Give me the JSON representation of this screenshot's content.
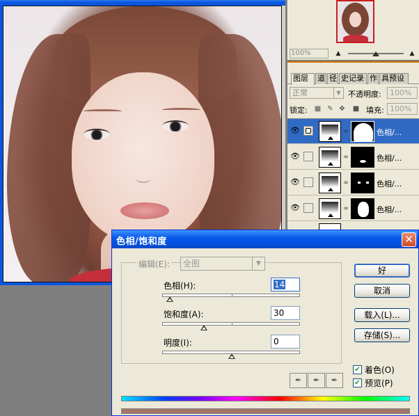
{
  "navigator": {
    "zoom": "100%"
  },
  "layers_panel": {
    "tabs": [
      "图层",
      "通道",
      "路径",
      "历史记录",
      "动作",
      "工具预设"
    ],
    "tab_labels_visible": [
      "图层",
      "道",
      "径",
      "史记录",
      "作",
      "具预设"
    ],
    "blend_mode": "正常",
    "opacity_label": "不透明度:",
    "opacity_value": "100%",
    "lock_label": "锁定:",
    "fill_label": "填充:",
    "fill_value": "100%",
    "layers": [
      {
        "name": "色相/...",
        "visible": true,
        "selected": true,
        "mask": "face-hair"
      },
      {
        "name": "色相/...",
        "visible": true,
        "selected": false,
        "mask": "lips"
      },
      {
        "name": "色相/...",
        "visible": true,
        "selected": false,
        "mask": "eyes"
      },
      {
        "name": "色相/...",
        "visible": true,
        "selected": false,
        "mask": "face"
      }
    ]
  },
  "dialog": {
    "title": "色相/饱和度",
    "edit_label": "编辑(E):",
    "edit_value": "全图",
    "hue_label": "色相(H):",
    "hue_value": "14",
    "saturation_label": "饱和度(A):",
    "saturation_value": "30",
    "lightness_label": "明度(I):",
    "lightness_value": "0",
    "hue_position": 0.05,
    "saturation_position": 0.3,
    "lightness_position": 0.5,
    "ok_label": "好",
    "cancel_label": "取消",
    "load_label": "载入(L)...",
    "save_label": "存储(S)...",
    "colorize_label": "着色(O)",
    "colorize_checked": true,
    "preview_label": "预览(P)",
    "preview_checked": true,
    "colorized_color": "#a4766a"
  },
  "colors": {
    "xp_title_blue": "#0a5ae8",
    "selection_blue": "#316ac5",
    "panel_bg": "#ece9d8"
  }
}
